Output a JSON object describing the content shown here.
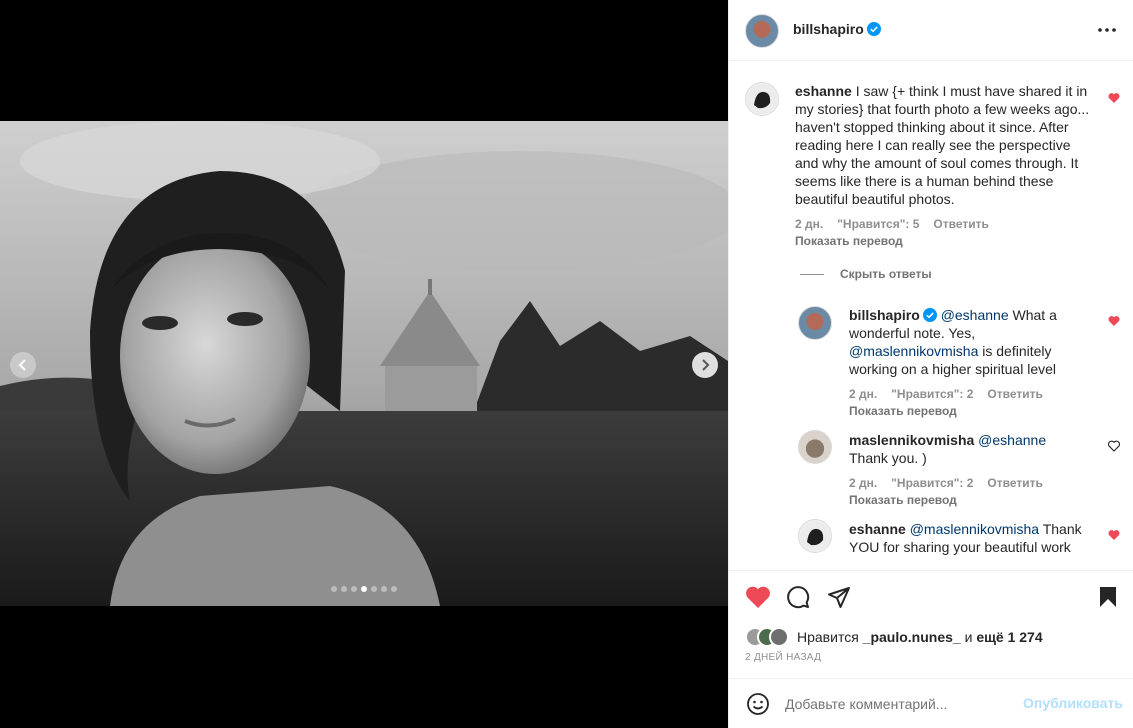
{
  "post": {
    "author": "billshapiro",
    "verified": true,
    "carousel": {
      "total_slides": 7,
      "active_slide": 4
    }
  },
  "comments": [
    {
      "user": "eshanne",
      "text": "I saw {+ think I must have shared it in my stories} that fourth photo a few weeks ago... haven't stopped thinking about it since. After reading here I can really see the perspective and why the amount of soul comes through. It seems like there is a human behind these beautiful beautiful photos.",
      "time": "2 дн.",
      "likes": "\"Нравится\": 5",
      "reply": "Ответить",
      "translate": "Показать перевод",
      "liked": true
    }
  ],
  "hide_replies": "Скрыть ответы",
  "replies": [
    {
      "user": "billshapiro",
      "verified": true,
      "mention": "@eshanne",
      "text_a": " What a wonderful note. Yes, ",
      "mention2": "@maslennikovmisha",
      "text_b": " is definitely working on a higher spiritual level",
      "time": "2 дн.",
      "likes": "\"Нравится\": 2",
      "reply": "Ответить",
      "translate": "Показать перевод",
      "liked": true
    },
    {
      "user": "maslennikovmisha",
      "mention": "@eshanne",
      "text": " Thank you. )",
      "time": "2 дн.",
      "likes": "\"Нравится\": 2",
      "reply": "Ответить",
      "translate": "Показать перевод",
      "liked": false
    },
    {
      "user": "eshanne",
      "mention": "@maslennikovmisha",
      "text": " Thank YOU for sharing your beautiful work",
      "liked": true
    }
  ],
  "likes": {
    "prefix": "Нравится ",
    "user": "_paulo.nunes_",
    "middle": " и ",
    "count": "ещё 1 274"
  },
  "date": "2 ДНЕЙ НАЗАД",
  "add_comment": {
    "placeholder": "Добавьте комментарий...",
    "publish": "Опубликовать"
  },
  "colors": {
    "like_red": "#ed4956",
    "link": "#00376b",
    "verified": "#0095f6",
    "publish_disabled": "#b2dffc"
  }
}
